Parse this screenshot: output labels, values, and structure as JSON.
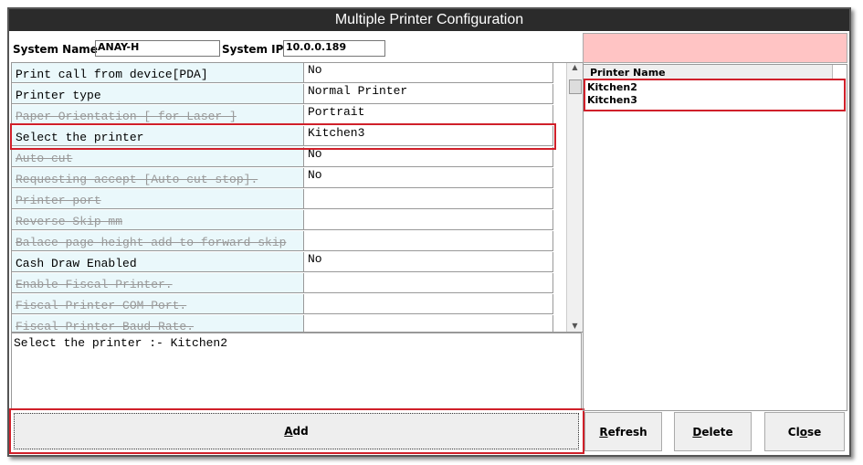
{
  "title": "Multiple Printer Configuration",
  "system_name_label": "System Name",
  "system_name": "ANAY-H",
  "system_ip_label": "System IP",
  "system_ip": "10.0.0.189",
  "rows": [
    {
      "name": "Print call from device[PDA]",
      "value": "No",
      "disabled": false
    },
    {
      "name": "Printer type",
      "value": "Normal Printer",
      "disabled": false
    },
    {
      "name": "Paper Orientation [ for Laser ]",
      "value": "Portrait",
      "disabled": true
    },
    {
      "name": "Select the printer",
      "value": "Kitchen3",
      "disabled": false
    },
    {
      "name": "Auto cut",
      "value": "No",
      "disabled": true
    },
    {
      "name": "Requesting accept [Auto cut stop].",
      "value": "No",
      "disabled": true
    },
    {
      "name": "Printer port",
      "value": "",
      "disabled": true
    },
    {
      "name": "Reverse Skip mm",
      "value": "",
      "disabled": true
    },
    {
      "name": "Balace page height add to forward skip",
      "value": "",
      "disabled": true
    },
    {
      "name": "Cash Draw Enabled",
      "value": "No",
      "disabled": false
    },
    {
      "name": "Enable Fiscal Printer.",
      "value": "",
      "disabled": true
    },
    {
      "name": "Fiscal Printer COM Port.",
      "value": "",
      "disabled": true
    },
    {
      "name": "Fiscal Printer Baud Rate.",
      "value": "",
      "disabled": true
    }
  ],
  "description": "Select the printer :- Kitchen2",
  "printer_list": {
    "header": "Printer Name",
    "items": [
      "Kitchen2",
      "Kitchen3"
    ]
  },
  "buttons": {
    "add": {
      "m": "A",
      "r": "dd"
    },
    "refresh": {
      "m": "R",
      "r": "efresh"
    },
    "delete": {
      "m": "D",
      "r": "elete"
    },
    "close": {
      "l": "Cl",
      "m": "o",
      "r": "se"
    }
  }
}
